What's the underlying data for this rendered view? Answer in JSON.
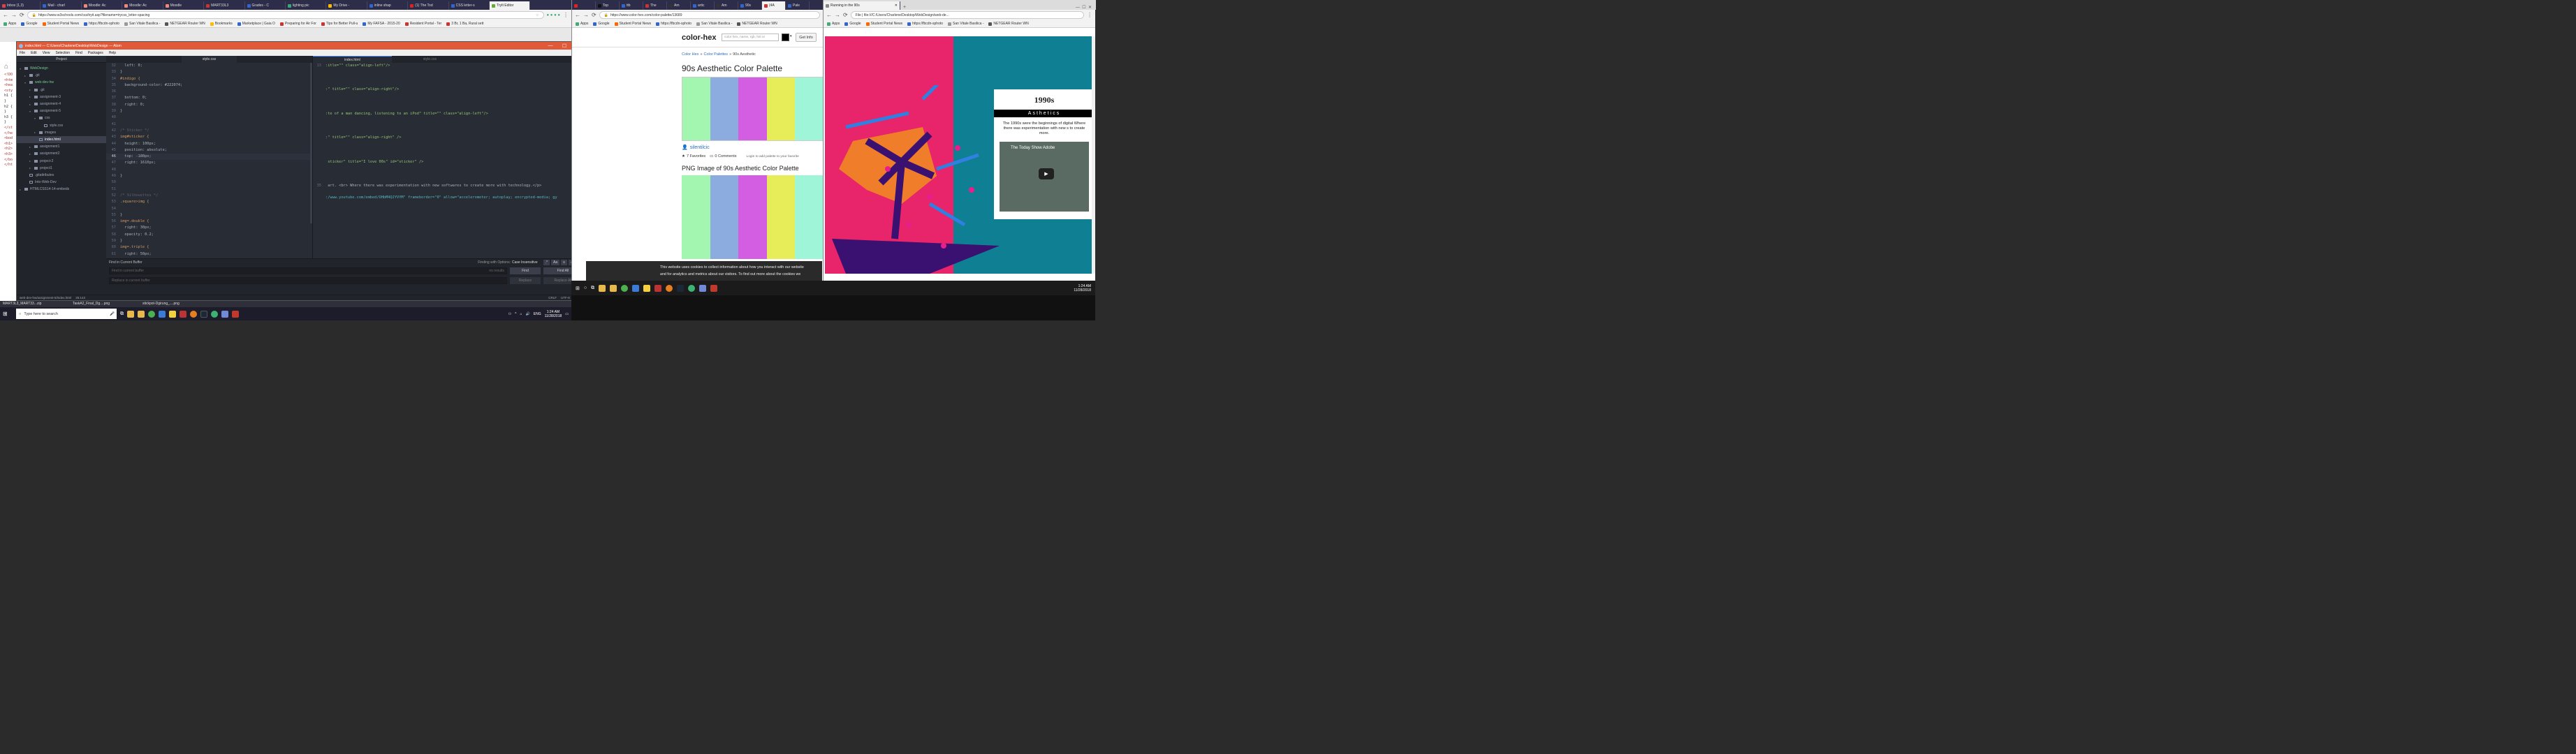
{
  "left_browser": {
    "tabs": [
      "Inbox (1,3)",
      "Mail - charl",
      "Moodle: Ac",
      "Moodle: Ac",
      "Moodle",
      "MART33L3",
      "Grades - C",
      "lighting pic",
      "My Drive -",
      "inline shap",
      "(1) The Tod",
      "CSS letter-s",
      "TryIt Editor"
    ],
    "url": "https://www.w3schools.com/css/tryit.asp?filename=trycss_letter-spacing",
    "bookmarks": [
      "Apps",
      "Google",
      "Student Portal News",
      "https://fbcdn-sphoto",
      "San Vitale Basilica -",
      "NETGEAR Router WN",
      "Bookmarks",
      "Marketplace | Gaia O",
      "Preparing for Air For",
      "Tips for Better Pull-u",
      "My FAFSA - 2015-20",
      "Resident Portal - Ter",
      "3 Br, 1 Ba, Rural sett"
    ],
    "code_peek": [
      "<!DO",
      "<htm",
      "<hea",
      "<sty",
      "h1 {",
      "}",
      "h2 {",
      "}",
      "h3 {",
      "}",
      "</st",
      "</he",
      "<bod",
      "<h1>",
      "<h2>",
      "<h3>",
      "</bo",
      "</ht"
    ]
  },
  "atom": {
    "title": "index.html — C:\\Users\\Charlene\\Desktop\\WebDesign — Atom",
    "menu": [
      "File",
      "Edit",
      "View",
      "Selection",
      "Find",
      "Packages",
      "Help"
    ],
    "project_header": "Project",
    "tree": [
      {
        "label": "WebDesign",
        "level": 0,
        "type": "folder-open"
      },
      {
        "label": ".git",
        "level": 1,
        "type": "folder"
      },
      {
        "label": "web-dev-hw",
        "level": 1,
        "type": "folder-open"
      },
      {
        "label": ".git",
        "level": 2,
        "type": "folder"
      },
      {
        "label": "assignment-3",
        "level": 2,
        "type": "folder"
      },
      {
        "label": "assignment-4",
        "level": 2,
        "type": "folder"
      },
      {
        "label": "assignment-5",
        "level": 2,
        "type": "folder-open"
      },
      {
        "label": "css",
        "level": 3,
        "type": "folder-open"
      },
      {
        "label": "style.css",
        "level": 4,
        "type": "file"
      },
      {
        "label": "images",
        "level": 3,
        "type": "folder"
      },
      {
        "label": "index.html",
        "level": 3,
        "type": "file-selected"
      },
      {
        "label": "assignment1",
        "level": 2,
        "type": "folder"
      },
      {
        "label": "assignment2",
        "level": 2,
        "type": "folder"
      },
      {
        "label": "project-2",
        "level": 2,
        "type": "folder"
      },
      {
        "label": "project1",
        "level": 2,
        "type": "folder"
      },
      {
        "label": ".gitattributes",
        "level": 1,
        "type": "file"
      },
      {
        "label": "Into-Web-Dev",
        "level": 1,
        "type": "file"
      },
      {
        "label": "HTMLCSS14-14-embeds",
        "level": 0,
        "type": "folder"
      }
    ],
    "left_pane_tab": "style.css",
    "right_pane_tabs": [
      "index.html",
      "style.css"
    ],
    "css_lines": [
      {
        "n": "32",
        "t": "  left: 0;"
      },
      {
        "n": "33",
        "t": "}"
      },
      {
        "n": "34",
        "t": "#indigo {"
      },
      {
        "n": "35",
        "t": "  background-color: #222074;"
      },
      {
        "n": "36",
        "t": ""
      },
      {
        "n": "37",
        "t": "  bottom: 0;"
      },
      {
        "n": "38",
        "t": "  right: 0;"
      },
      {
        "n": "39",
        "t": "}"
      },
      {
        "n": "40",
        "t": ""
      },
      {
        "n": "41",
        "t": ""
      },
      {
        "n": "42",
        "t": "/* Sticker */"
      },
      {
        "n": "43",
        "t": "img#sticker {"
      },
      {
        "n": "44",
        "t": "  height: 100px;"
      },
      {
        "n": "45",
        "t": "  position: absolute;"
      },
      {
        "n": "46",
        "t": "  top: -180px;"
      },
      {
        "n": "47",
        "t": "  right: 1610px;"
      },
      {
        "n": "48",
        "t": ""
      },
      {
        "n": "49",
        "t": "}"
      },
      {
        "n": "50",
        "t": ""
      },
      {
        "n": "51",
        "t": ""
      },
      {
        "n": "52",
        "t": "/* Silhouettes */"
      },
      {
        "n": "53",
        "t": ".square>img {"
      },
      {
        "n": "54",
        "t": ""
      },
      {
        "n": "55",
        "t": "}"
      },
      {
        "n": "56",
        "t": "img=.double {"
      },
      {
        "n": "57",
        "t": "  right: 30px;"
      },
      {
        "n": "58",
        "t": "  opacity: 0.2;"
      },
      {
        "n": "59",
        "t": "}"
      },
      {
        "n": "60",
        "t": "img=.triple {"
      },
      {
        "n": "61",
        "t": "  right: 50px;"
      }
    ],
    "html_lines": [
      {
        "n": "13",
        "t": ":itle=\"\" class=\"align-left\"/>"
      },
      {
        "n": "",
        "t": ""
      },
      {
        "n": "",
        "t": ""
      },
      {
        "n": "",
        "t": ""
      },
      {
        "n": "",
        "t": ":\" title=\"\" class=\"align-right\"/>"
      },
      {
        "n": "",
        "t": ""
      },
      {
        "n": "",
        "t": ""
      },
      {
        "n": "",
        "t": ""
      },
      {
        "n": "",
        "t": ":te of a man dancing, listening to an iPod\" title=\"\" class=\"align-left\"/>"
      },
      {
        "n": "",
        "t": ""
      },
      {
        "n": "",
        "t": ""
      },
      {
        "n": "",
        "t": ""
      },
      {
        "n": "",
        "t": ":\" title=\"\" class=\"align-right\" />"
      },
      {
        "n": "",
        "t": ""
      },
      {
        "n": "",
        "t": ""
      },
      {
        "n": "",
        "t": ""
      },
      {
        "n": "",
        "t": " sticker\" title=\"I love 00s\" id=\"sticker\" />"
      },
      {
        "n": "",
        "t": ""
      },
      {
        "n": "",
        "t": ""
      },
      {
        "n": "",
        "t": ""
      },
      {
        "n": "35",
        "t": " art. <br> Where there was experimentation with new softwares to create more with technology.</p>"
      },
      {
        "n": "",
        "t": ""
      },
      {
        "n": "",
        "t": ":/www.youtube.com/embed/OHbM4QJYVYM\" frameborder=\"0\" allow=\"accelerometer; autoplay; encrypted-media; gy"
      }
    ],
    "find": {
      "label": "Find in Current Buffer",
      "options_label": "Finding with Options:",
      "options_value": "Case Insensitive",
      "find_placeholder": "Find in current buffer",
      "replace_placeholder": "Replace in current buffer",
      "no_results": "no results",
      "find_btn": "Find",
      "find_all_btn": "Find All",
      "replace_btn": "Replace",
      "replace_all_btn": "Replace All"
    },
    "status_left": "web-dev-hw/assignment-5/index.html",
    "status_pos": "25:143",
    "status_right": [
      "CRLF",
      "UTF-8",
      "HTML"
    ]
  },
  "mid_browser": {
    "tabs": [
      "",
      "Top",
      "ttb",
      "The",
      "Am",
      "artic",
      "Am",
      "90s",
      "(4A",
      "Pale"
    ],
    "url": "https://www.color-hex.com/color-palette/13689",
    "bookmarks": [
      "Apps",
      "Google",
      "Student Portal News",
      "https://fbcdn-sphoto",
      "San Vitale Basilica -",
      "NETGEAR Router WN"
    ],
    "logo": "color-hex",
    "search_placeholder": "color hex, name, rgb, hsl or",
    "get_info": "Get Info",
    "breadcrumb": [
      "Color Hex",
      "»",
      "Color Palettes",
      "»",
      "90s Aesthetic"
    ],
    "title": "90s Aesthetic Color Palette",
    "swatches": [
      "#a2f6b0",
      "#8cacdf",
      "#d35ee2",
      "#e7ed59",
      "#9ef5d8"
    ],
    "author": "silentilcic",
    "favorites": "7 Favorites",
    "comments": "0 Comments",
    "login_text": "Login to add palette to your favorite",
    "png_title": "PNG Image of 90s Aesthetic Color Palette",
    "cookie_line1": "This website uses cookies to collect information about how you interact with our website",
    "cookie_line2": "and for analytics and metrics about our visitors. To find out more about the cookies we"
  },
  "right_browser": {
    "tab_title": "Running in the 90s",
    "url": "File | file:///C:/Users/Charlene/Desktop/WebDesign/web-de...",
    "bookmarks": [
      "Apps",
      "Google",
      "Student Portal News",
      "https://fbcdn-sphoto",
      "San Vitale Basilica -",
      "NETGEAR Router WN"
    ],
    "heading": "1990s",
    "subheading": "Asthetics",
    "body": "The 1990s were the beginnings of digital Where there was experimentation with new s to create more.",
    "video_title": "The Today Show Adobe"
  },
  "taskbar_small": {
    "time": "1:24 AM",
    "date": "11/28/2018"
  },
  "taskbar": {
    "files": [
      "MART3L3_MART33...zip",
      "TaskA2_Final_Dg....png",
      "stickpot-Dgirung_....png"
    ],
    "search": "Type here to search",
    "lang": "ENG",
    "time": "1:24 AM",
    "date": "11/28/2018"
  }
}
